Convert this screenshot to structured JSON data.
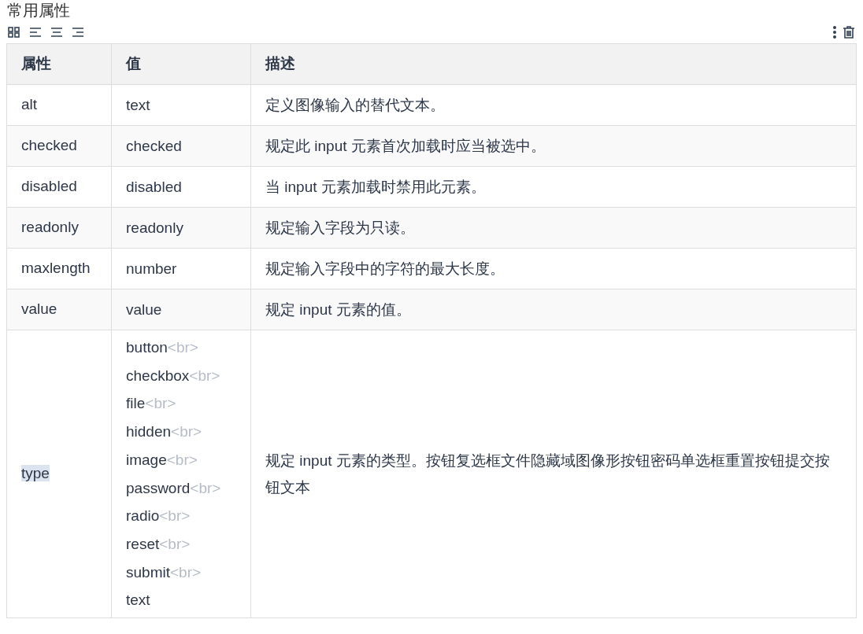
{
  "title": "常用属性",
  "columns": [
    "属性",
    "值",
    "描述"
  ],
  "rows": [
    {
      "attribute": "alt",
      "highlighted": false,
      "values": [
        {
          "text": "text"
        }
      ],
      "description": "定义图像输入的替代文本。"
    },
    {
      "attribute": "checked",
      "highlighted": false,
      "values": [
        {
          "text": "checked"
        }
      ],
      "description": "规定此 input 元素首次加载时应当被选中。"
    },
    {
      "attribute": "disabled",
      "highlighted": false,
      "values": [
        {
          "text": "disabled"
        }
      ],
      "description": "当 input 元素加载时禁用此元素。"
    },
    {
      "attribute": "readonly",
      "highlighted": false,
      "values": [
        {
          "text": "readonly"
        }
      ],
      "description": "规定输入字段为只读。"
    },
    {
      "attribute": "maxlength",
      "highlighted": false,
      "values": [
        {
          "text": "number"
        }
      ],
      "description": "规定输入字段中的字符的最大长度。"
    },
    {
      "attribute": "value",
      "highlighted": false,
      "values": [
        {
          "text": "value"
        }
      ],
      "description": "规定 input 元素的值。"
    },
    {
      "attribute": "type",
      "highlighted": true,
      "values": [
        {
          "text": "button",
          "tag": "<br>"
        },
        {
          "text": "checkbox",
          "tag": "<br>"
        },
        {
          "text": "file",
          "tag": "<br>"
        },
        {
          "text": "hidden",
          "tag": "<br>"
        },
        {
          "text": "image",
          "tag": "<br>"
        },
        {
          "text": "password",
          "tag": "<br>"
        },
        {
          "text": "radio",
          "tag": "<br>"
        },
        {
          "text": "reset",
          "tag": "<br>"
        },
        {
          "text": "submit",
          "tag": "<br>"
        },
        {
          "text": "text"
        }
      ],
      "description": "规定 input 元素的类型。按钮复选框文件隐藏域图像形按钮密码单选框重置按钮提交按钮文本"
    }
  ]
}
